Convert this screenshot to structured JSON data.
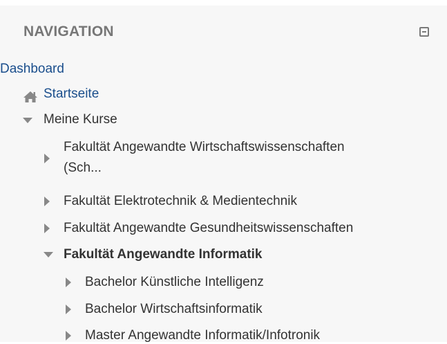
{
  "navigation": {
    "title": "NAVIGATION",
    "collapse_icon": "minus-square-icon",
    "items": {
      "dashboard": "Dashboard",
      "startseite": "Startseite",
      "meine_kurse": "Meine Kurse",
      "faculties": [
        {
          "label_line1": "Fakultät Angewandte Wirtschaftswissenschaften",
          "label_line2": "(Sch..."
        },
        {
          "label": "Fakultät Elektrotechnik & Medientechnik"
        },
        {
          "label": "Fakultät Angewandte Gesundheitswissenschaften"
        },
        {
          "label": "Fakultät Angewandte Informatik"
        }
      ],
      "programs": [
        "Bachelor Künstliche Intelligenz",
        "Bachelor Wirtschaftsinformatik",
        "Master Angewandte Informatik/Infotronik"
      ]
    },
    "icons": {
      "home": "home-icon",
      "expanded": "triangle-down-icon",
      "collapsed": "triangle-right-icon"
    },
    "colors": {
      "link": "#1a4e8c",
      "text": "#333333",
      "title": "#777777",
      "background": "#f7f7f7"
    }
  }
}
